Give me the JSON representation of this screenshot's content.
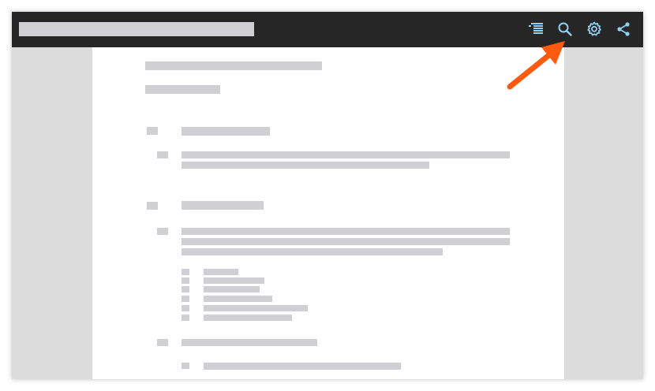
{
  "toolbar": {
    "icons": [
      "table-of-contents-icon",
      "search-icon",
      "settings-gear-icon",
      "share-icon"
    ],
    "icon_color": "#8fd0f2",
    "background": "#262626"
  },
  "callout": {
    "arrow_color": "#ff5a0e",
    "points_to": "search-icon"
  },
  "document": {
    "placeholder_color": "#cfcfd4"
  }
}
